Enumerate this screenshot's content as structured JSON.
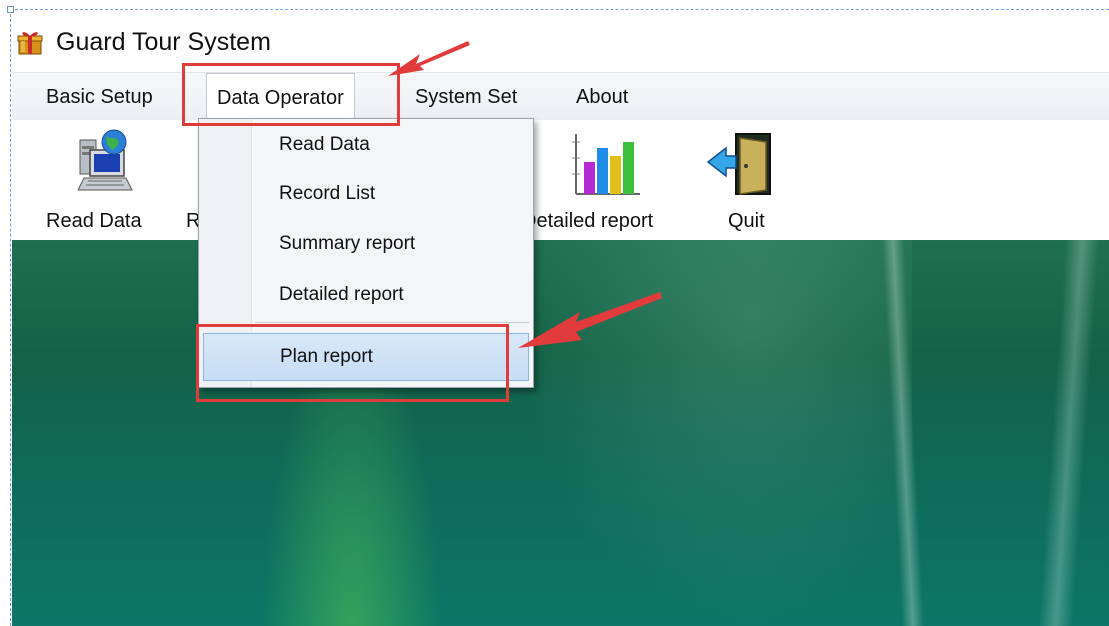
{
  "window": {
    "title": "Guard Tour System"
  },
  "menubar": {
    "items": [
      {
        "label": "Basic Setup"
      },
      {
        "label": "Data Operator"
      },
      {
        "label": "System Set"
      },
      {
        "label": "About"
      }
    ]
  },
  "toolbar": {
    "buttons": [
      {
        "label": "Read Data",
        "icon": "computer-globe-icon"
      },
      {
        "label": "R",
        "icon": "hidden"
      },
      {
        "label": "Detailed report",
        "icon": "bar-chart-icon"
      },
      {
        "label": "Quit",
        "icon": "exit-door-icon"
      }
    ]
  },
  "dropdown": {
    "items": [
      {
        "label": "Read Data"
      },
      {
        "label": "Record List"
      },
      {
        "label": "Summary report"
      },
      {
        "label": "Detailed report"
      },
      {
        "label": "Plan report"
      }
    ],
    "hovered": "Plan report"
  },
  "annotations": {
    "color": "#e23b3b"
  },
  "colors": {
    "content_background": "#146247",
    "menu_hover": "#c7ddf4",
    "highlight": "#e23b3b"
  }
}
